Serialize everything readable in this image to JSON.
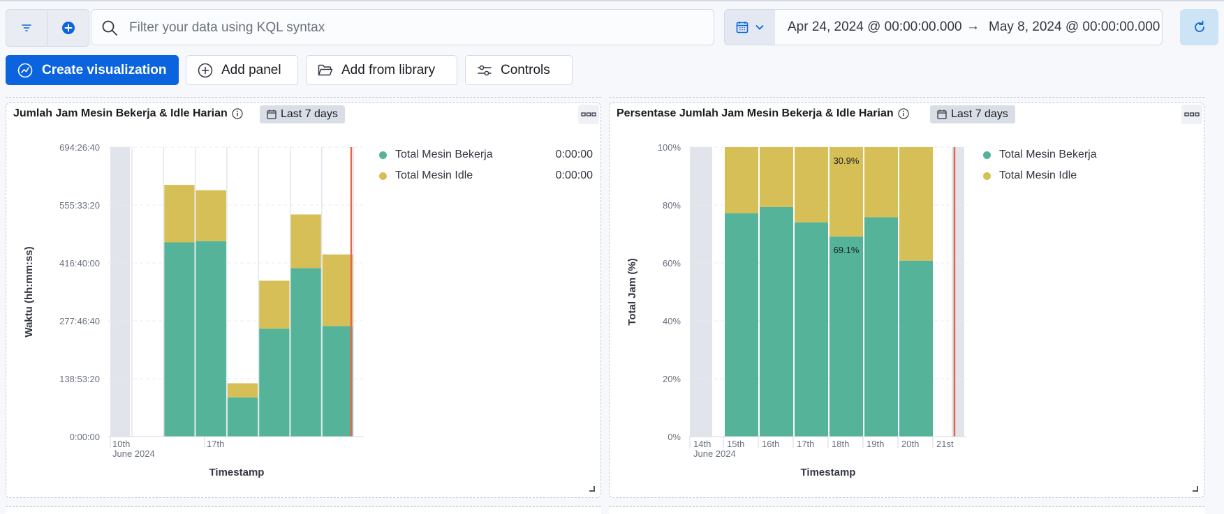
{
  "query": {
    "placeholder": "Filter your data using KQL syntax",
    "date_start": "Apr 24, 2024 @ 00:00:00.000",
    "date_arrow": "→",
    "date_end": "May 8, 2024 @ 00:00:00.000"
  },
  "toolbar": {
    "create_label": "Create visualization",
    "add_panel_label": "Add panel",
    "add_library_label": "Add from library",
    "controls_label": "Controls"
  },
  "colors": {
    "working": "#54b399",
    "idle": "#d6bf57",
    "primary": "#0b64dd",
    "marker": "#e7664c"
  },
  "panels": [
    {
      "title": "Jumlah Jam Mesin Bekerja & Idle Harian",
      "badge": "Last 7 days",
      "legend": [
        {
          "label": "Total Mesin Bekerja",
          "value": "0:00:00"
        },
        {
          "label": "Total Mesin Idle",
          "value": "0:00:00"
        }
      ]
    },
    {
      "title": "Persentase Jumlah Jam Mesin Bekerja & Idle Harian",
      "badge": "Last 7 days",
      "legend": [
        {
          "label": "Total Mesin Bekerja"
        },
        {
          "label": "Total Mesin Idle"
        }
      ]
    }
  ],
  "chart_data": [
    {
      "type": "bar",
      "stacked": true,
      "ylabel": "Waktu (hh:mm:ss)",
      "xlabel": "Timestamp",
      "y_ticks": [
        "0:00:00",
        "138:53:20",
        "277:46:40",
        "416:40:00",
        "555:33:20",
        "694:26:40"
      ],
      "ylim_hours": [
        0,
        694.44
      ],
      "x_ticks": [
        {
          "label": "10th",
          "sublabel": "June 2024",
          "at": 0
        },
        {
          "label": "17th",
          "at": 3
        }
      ],
      "categories": [
        "Jun 14",
        "Jun 15",
        "Jun 16",
        "Jun 17",
        "Jun 18",
        "Jun 19",
        "Jun 20",
        "Jun 21"
      ],
      "series": [
        {
          "name": "Total Mesin Bekerja",
          "values_hours": [
            null,
            466,
            469,
            94,
            259,
            404,
            265,
            null
          ]
        },
        {
          "name": "Total Mesin Idle",
          "values_hours": [
            null,
            138,
            122,
            34,
            115,
            129,
            172,
            null
          ]
        }
      ],
      "shaded_range": "10th–14th",
      "now_marker": "Jun 21"
    },
    {
      "type": "bar",
      "stacked": true,
      "ylabel": "Total Jam (%)",
      "xlabel": "Timestamp",
      "y_ticks": [
        "0%",
        "20%",
        "40%",
        "60%",
        "80%",
        "100%"
      ],
      "ylim": [
        0,
        100
      ],
      "x_ticks": [
        {
          "label": "14th",
          "sublabel": "June 2024"
        },
        {
          "label": "15th"
        },
        {
          "label": "16th"
        },
        {
          "label": "17th"
        },
        {
          "label": "18th"
        },
        {
          "label": "19th"
        },
        {
          "label": "20th"
        },
        {
          "label": "21st"
        }
      ],
      "categories": [
        "15th",
        "16th",
        "17th",
        "18th",
        "19th",
        "20th"
      ],
      "series": [
        {
          "name": "Total Mesin Bekerja",
          "values": [
            77.2,
            79.3,
            74.0,
            69.1,
            75.8,
            60.8
          ]
        },
        {
          "name": "Total Mesin Idle",
          "values": [
            22.8,
            20.7,
            26.0,
            30.9,
            24.2,
            39.2
          ]
        }
      ],
      "annotations": [
        {
          "text": "30.9%",
          "category": "18th",
          "series": "Total Mesin Idle"
        },
        {
          "text": "69.1%",
          "category": "18th",
          "series": "Total Mesin Bekerja"
        }
      ],
      "now_marker": "21st"
    }
  ]
}
